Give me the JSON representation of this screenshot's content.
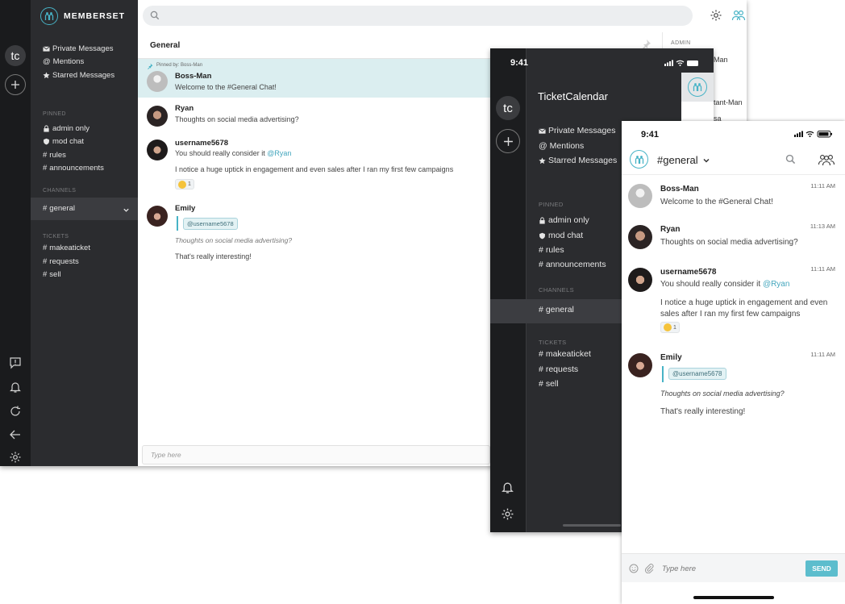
{
  "desktop": {
    "brand": "MEMBERSET",
    "workspace_badge": "tc",
    "nav": [
      "Private Messages",
      "Mentions",
      "Starred Messages"
    ],
    "pinned_label": "PINNED",
    "pinned": [
      "admin only",
      "mod chat",
      "rules",
      "announcements"
    ],
    "channels_label": "CHANNELS",
    "channels": [
      "general"
    ],
    "tickets_label": "TICKETS",
    "tickets": [
      "makeaticket",
      "requests",
      "sell"
    ],
    "channel_title": "General",
    "pinned_by": "Pinned by: Boss-Man",
    "admin_label": "ADMIN",
    "peek_members": [
      "Man",
      "tant-Man",
      "sa"
    ],
    "composer_placeholder": "Type here",
    "messages": [
      {
        "name": "Boss-Man",
        "text": "Welcome to the #General Chat!"
      },
      {
        "name": "Ryan",
        "text": "Thoughts on social media advertising?"
      },
      {
        "name": "username5678",
        "text": "You should really consider it ",
        "mention": "@Ryan",
        "text2": "I notice a huge uptick in engagement and even sales after I ran my first few campaigns",
        "reaction_count": "1"
      },
      {
        "name": "Emily",
        "quote": "@username5678",
        "quoted": "Thoughts on social media advertising?",
        "text": "That's really interesting!"
      }
    ]
  },
  "tablet": {
    "time": "9:41",
    "workspace_badge": "tc",
    "title": "TicketCalendar",
    "nav": [
      "Private Messages",
      "Mentions",
      "Starred Messages"
    ],
    "pinned_label": "PINNED",
    "pinned": [
      "admin only",
      "mod chat",
      "rules",
      "announcements"
    ],
    "channels_label": "CHANNELS",
    "channels": [
      "general"
    ],
    "tickets_label": "TICKETS",
    "tickets": [
      "makeaticket",
      "requests",
      "sell"
    ]
  },
  "phone": {
    "time": "9:41",
    "channel": "#general",
    "composer_placeholder": "Type here",
    "send_label": "SEND",
    "messages": [
      {
        "name": "Boss-Man",
        "time": "11:11 AM",
        "text": "Welcome to the #General Chat!"
      },
      {
        "name": "Ryan",
        "time": "11:13 AM",
        "text": "Thoughts on social media advertising?"
      },
      {
        "name": "username5678",
        "time": "11:11 AM",
        "text": "You should really consider it ",
        "mention": "@Ryan",
        "text2a": "I notice a huge uptick in engagement and even",
        "text2b": "sales after I ran my first few campaigns",
        "reaction_count": "1"
      },
      {
        "name": "Emily",
        "time": "11:11 AM",
        "quote": "@username5678",
        "quoted": "Thoughts on social media advertising?",
        "text": "That's really interesting!"
      }
    ]
  },
  "colors": {
    "accent": "#47b3c6",
    "sidebar": "#2b2c2f",
    "rail": "#1a1b1d",
    "pinned_bg": "#dbeef0",
    "send": "#5cbdcd"
  }
}
